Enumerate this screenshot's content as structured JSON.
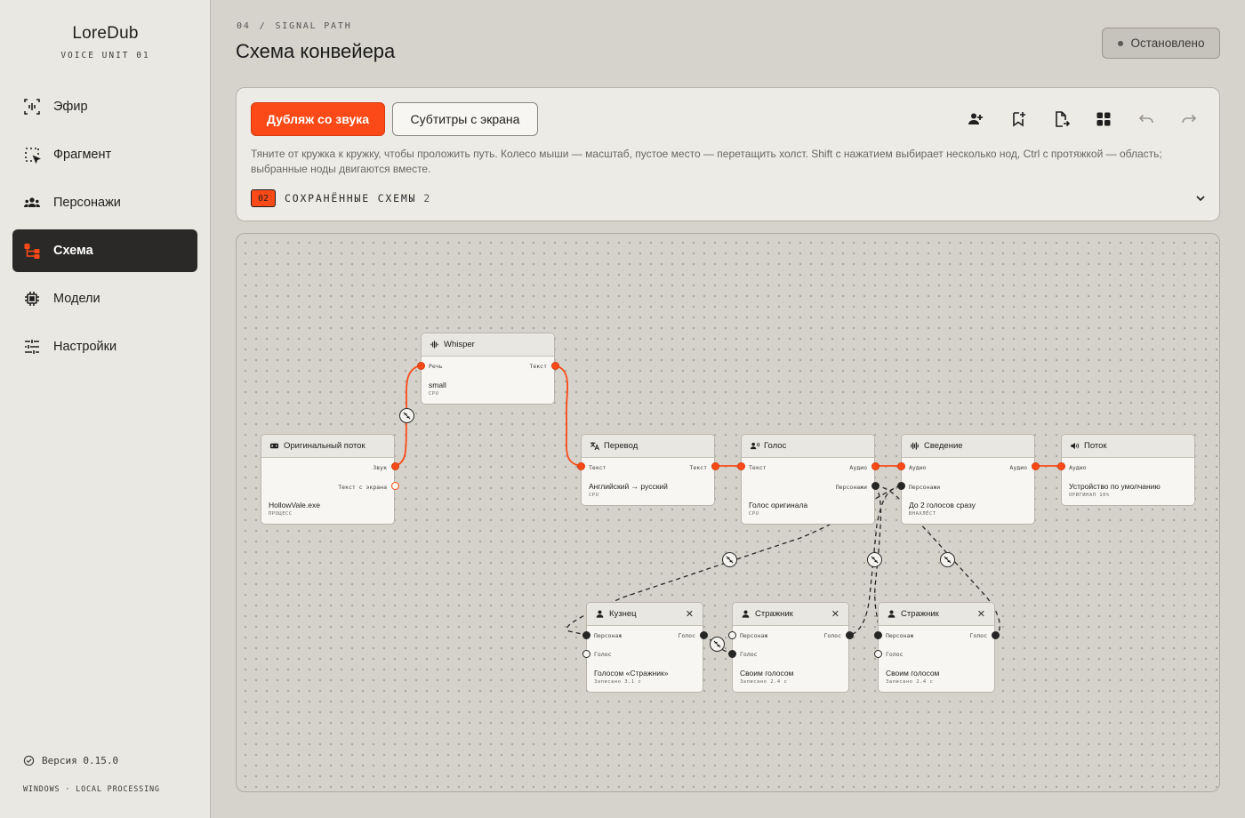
{
  "sidebar": {
    "brand": "LoreDub",
    "subtitle": "VOICE UNIT 01",
    "items": [
      {
        "label": "Эфир",
        "icon": "broadcast-icon"
      },
      {
        "label": "Фрагмент",
        "icon": "selection-icon"
      },
      {
        "label": "Персонажи",
        "icon": "group-icon"
      },
      {
        "label": "Схема",
        "icon": "flow-scheme-icon",
        "active": true
      },
      {
        "label": "Модели",
        "icon": "chip-icon"
      },
      {
        "label": "Настройки",
        "icon": "sliders-icon"
      }
    ],
    "version": "Версия 0.15.0",
    "platform": "WINDOWS · LOCAL PROCESSING"
  },
  "header": {
    "crumb_num": "04",
    "crumb_sep": "/",
    "crumb_label": "SIGNAL PATH",
    "title": "Схема конвейера",
    "status": "Остановлено"
  },
  "panel": {
    "primary_button": "Дубляж со звука",
    "secondary_button": "Субтитры с экрана",
    "tools": [
      "add-character-icon",
      "bookmark-add-icon",
      "file-export-icon",
      "grid-layout-icon",
      "undo-icon",
      "redo-icon"
    ],
    "hint": "Тяните от кружка к кружку, чтобы проложить путь. Колесо мыши — масштаб, пустое место — перетащить холст. Shift с нажатием выбирает несколько нод, Ctrl с протяжкой — область; выбранные ноды двигаются вместе.",
    "saved_count": "02",
    "saved_label": "СОХРАНЁННЫЕ СХЕМЫ",
    "saved_total": "2"
  },
  "colors": {
    "accent": "#fb4a17",
    "sidebar_active": "#2a2927",
    "canvas_bg": "#d5d2cb"
  },
  "nodes": {
    "source": {
      "title": "Оригинальный поток",
      "icon": "game-window-icon",
      "out1": "Звук",
      "out2": "Текст с экрана",
      "main": "HollowVale.exe",
      "sub": "ПРОЦЕСС"
    },
    "whisper": {
      "title": "Whisper",
      "icon": "waveform-icon",
      "in1": "Речь",
      "out1": "Текст",
      "main": "small",
      "sub": "CPU"
    },
    "translate": {
      "title": "Перевод",
      "icon": "translate-icon",
      "in1": "Текст",
      "out1": "Текст",
      "main": "Английский → русский",
      "sub": "CPU"
    },
    "voice": {
      "title": "Голос",
      "icon": "voice-icon",
      "in1": "Текст",
      "out1": "Аудио",
      "out2": "Персонажи",
      "main": "Голос оригинала",
      "sub": "CPU"
    },
    "mix": {
      "title": "Сведение",
      "icon": "mixer-icon",
      "in1": "Аудио",
      "out1": "Аудио",
      "in2": "Персонажи",
      "main": "До 2 голосов сразу",
      "sub": "ВНАХЛЁСТ"
    },
    "output": {
      "title": "Поток",
      "icon": "speaker-icon",
      "in1": "Аудио",
      "main": "Устройство по умолчанию",
      "sub": "ОРИГИНАЛ 10%"
    },
    "char1": {
      "title": "Кузнец",
      "icon": "person-icon",
      "in1": "Персонаж",
      "out1": "Голос",
      "in2": "Голос",
      "main": "Голосом «Стражник»",
      "sub": "Записано 3.1 с"
    },
    "char2": {
      "title": "Стражник",
      "icon": "person-icon",
      "in1": "Персонаж",
      "out1": "Голос",
      "in2": "Голос",
      "main": "Своим голосом",
      "sub": "Записано 2.4 с"
    },
    "char3": {
      "title": "Стражник",
      "icon": "person-icon",
      "in1": "Персонаж",
      "out1": "Голос",
      "in2": "Голос",
      "main": "Своим голосом",
      "sub": "Записано 2.4 с"
    }
  }
}
